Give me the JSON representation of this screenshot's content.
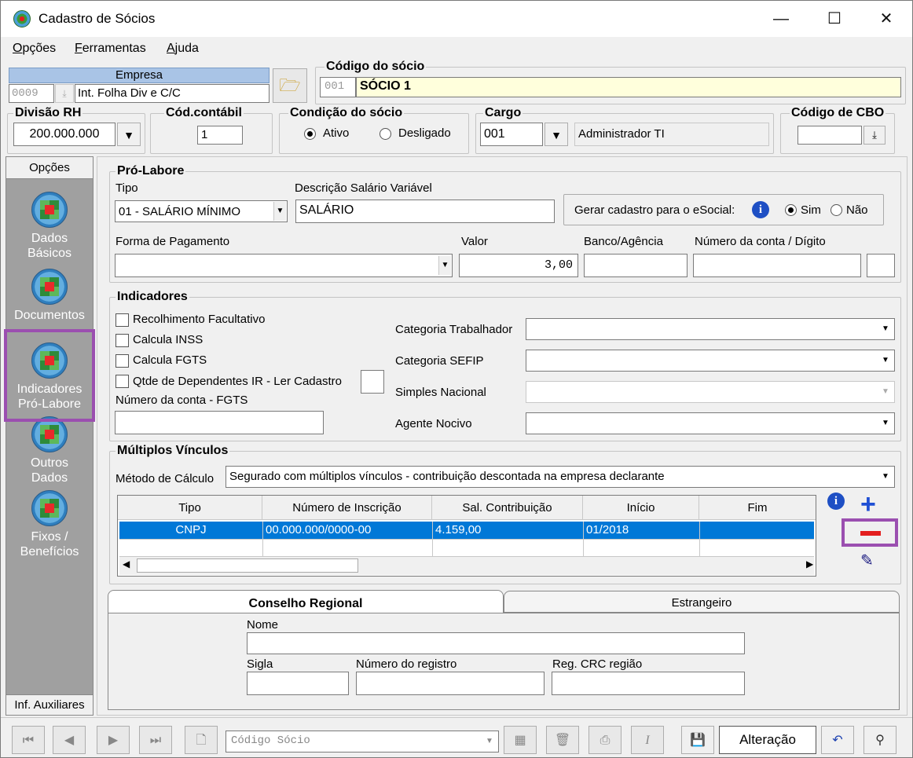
{
  "window": {
    "title": "Cadastro de Sócios",
    "controls": {
      "minimize": "—",
      "maximize": "☐",
      "close": "✕"
    }
  },
  "menu": {
    "items": [
      {
        "label_first": "O",
        "label_rest": "pções"
      },
      {
        "label_first": "F",
        "label_rest": "erramentas"
      },
      {
        "label_first": "A",
        "label_rest": "juda"
      }
    ]
  },
  "empresa": {
    "label": "Empresa",
    "code": "0009",
    "name": "Int. Folha Div e C/C"
  },
  "codigo_socio": {
    "label": "Código do sócio",
    "code": "001",
    "name": "SÓCIO 1"
  },
  "divisao_rh": {
    "label": "Divisão RH",
    "value": "200.000.000"
  },
  "cod_contabil": {
    "label": "Cód.contábil",
    "value": "1"
  },
  "condicao": {
    "label": "Condição do sócio",
    "options": [
      "Ativo",
      "Desligado"
    ],
    "selected": "Ativo"
  },
  "cargo": {
    "label": "Cargo",
    "code": "001",
    "name": "Administrador TI"
  },
  "cbo": {
    "label": "Código de CBO",
    "value": ""
  },
  "sidebar": {
    "header": "Opções",
    "items": [
      {
        "label1": "Dados",
        "label2": "Básicos"
      },
      {
        "label1": "Documentos",
        "label2": ""
      },
      {
        "label1": "Indicadores",
        "label2": "Pró-Labore"
      },
      {
        "label1": "Outros",
        "label2": "Dados"
      },
      {
        "label1": "Fixos /",
        "label2": "Benefícios"
      }
    ],
    "footer": "Inf. Auxiliares"
  },
  "pro_labore": {
    "title": "Pró-Labore",
    "tipo_label": "Tipo",
    "tipo_value": "01 - SALÁRIO MÍNIMO",
    "desc_label": "Descrição Salário Variável",
    "desc_value": "SALÁRIO",
    "esocial_label": "Gerar cadastro para o eSocial:",
    "esocial_options": [
      "Sim",
      "Não"
    ],
    "esocial_selected": "Sim",
    "forma_label": "Forma de Pagamento",
    "forma_value": "",
    "valor_label": "Valor",
    "valor_value": "3,00",
    "banco_label": "Banco/Agência",
    "banco_value": "",
    "conta_label": "Número da conta / Dígito",
    "conta_value": "",
    "digito_value": ""
  },
  "indicadores": {
    "title": "Indicadores",
    "checks": [
      "Recolhimento Facultativo",
      "Calcula INSS",
      "Calcula FGTS",
      "Qtde de Dependentes IR - Ler Cadastro"
    ],
    "conta_fgts_label": "Número da conta - FGTS",
    "conta_fgts_value": "",
    "categoria_trab_label": "Categoria Trabalhador",
    "categoria_sefip_label": "Categoria SEFIP",
    "simples_label": "Simples Nacional",
    "agente_label": "Agente Nocivo"
  },
  "multiplos": {
    "title": "Múltiplos Vínculos",
    "metodo_label": "Método de Cálculo",
    "metodo_value": "Segurado com múltiplos vínculos - contribuição descontada na empresa declarante",
    "columns": [
      "Tipo",
      "Número de Inscrição",
      "Sal. Contribuição",
      "Início",
      "Fim"
    ],
    "rows": [
      {
        "tipo": "CNPJ",
        "inscricao": "00.000.000/0000-00",
        "sal": "4.159,00",
        "inicio": "01/2018",
        "fim": ""
      }
    ]
  },
  "tabs": {
    "items": [
      "Conselho Regional",
      "Estrangeiro"
    ],
    "active": "Conselho Regional",
    "nome_label": "Nome",
    "sigla_label": "Sigla",
    "registro_label": "Número do registro",
    "crc_label": "Reg. CRC região"
  },
  "toolbar": {
    "search_placeholder": "Código Sócio",
    "mode": "Alteração"
  },
  "colors": {
    "selection": "#0078d7",
    "highlight": "#9b4fb0",
    "yellow_field": "#ffffdc"
  }
}
